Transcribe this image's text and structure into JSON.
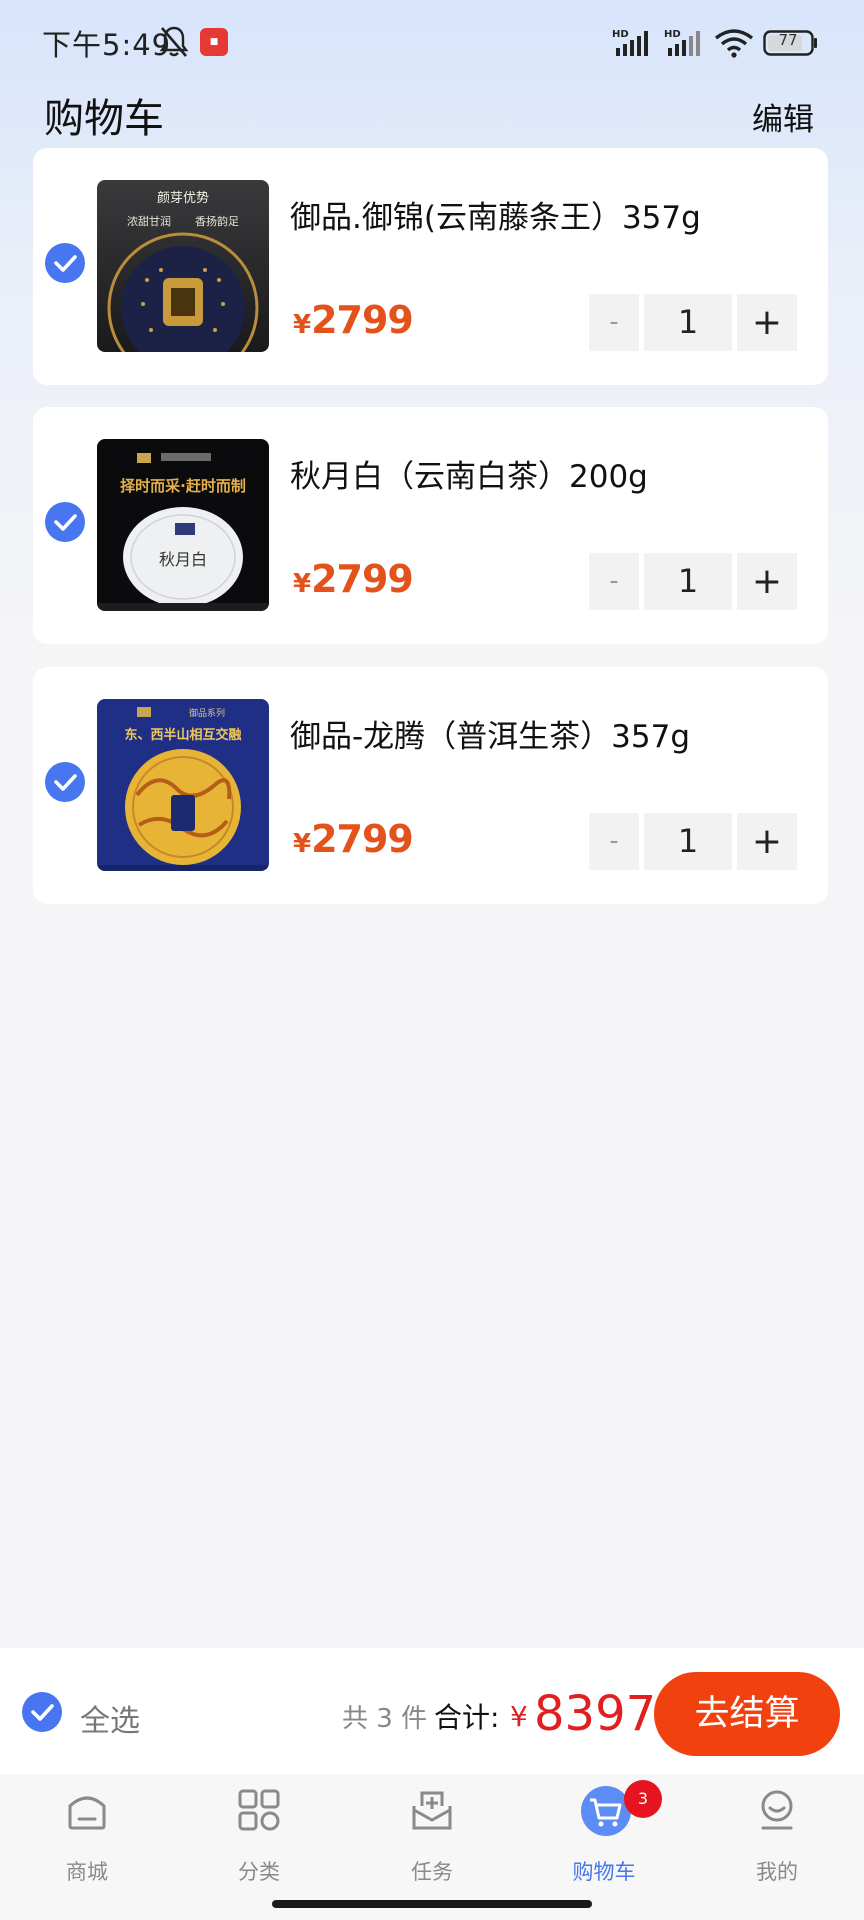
{
  "status_bar": {
    "time": "下午5:49",
    "signal_labels": [
      "HD",
      "HD"
    ],
    "battery": "77"
  },
  "header": {
    "title": "购物车",
    "edit_label": "编辑"
  },
  "cart": {
    "items": [
      {
        "name": "御品.御锦(云南藤条王）357g",
        "currency": "¥",
        "price": "2799",
        "quantity": "1",
        "minus_label": "-",
        "plus_label": "+",
        "checked": true,
        "image_icon": "tea-cake-yujin-image",
        "image_text": [
          "颜芽优势",
          "浓甜甘润",
          "香扬韵足"
        ]
      },
      {
        "name": "秋月白（云南白茶）200g",
        "currency": "¥",
        "price": "2799",
        "quantity": "1",
        "minus_label": "-",
        "plus_label": "+",
        "checked": true,
        "image_icon": "tea-cake-qiuyuebai-image",
        "image_text": [
          "择时而采·赶时而制",
          "秋月白"
        ]
      },
      {
        "name": "御品-龙腾（普洱生茶）357g",
        "currency": "¥",
        "price": "2799",
        "quantity": "1",
        "minus_label": "-",
        "plus_label": "+",
        "checked": true,
        "image_icon": "tea-cake-longteng-image",
        "image_text": [
          "御品系列",
          "东、西半山相互交融"
        ]
      }
    ]
  },
  "checkout": {
    "select_all_label": "全选",
    "count_text": "共 3 件",
    "total_label": "合计:",
    "currency": "¥",
    "total_value": "8397",
    "checkout_label": "去结算"
  },
  "tabs": [
    {
      "label": "商城",
      "icon": "home-icon"
    },
    {
      "label": "分类",
      "icon": "grid-icon"
    },
    {
      "label": "任务",
      "icon": "task-inbox-icon"
    },
    {
      "label": "购物车",
      "icon": "cart-icon",
      "badge": "3",
      "active": true
    },
    {
      "label": "我的",
      "icon": "profile-icon"
    }
  ],
  "colors": {
    "accent": "#4776f0",
    "price": "#e4521b",
    "checkout_button": "#f0410f",
    "badge": "#e5141f"
  }
}
